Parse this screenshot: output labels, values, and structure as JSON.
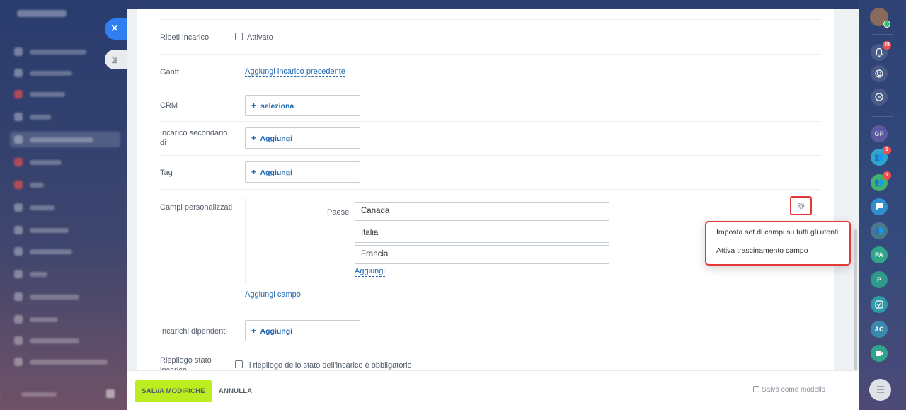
{
  "form": {
    "repeat_task": {
      "label": "Ripeti incarico",
      "checkbox_label": "Attivato"
    },
    "gantt": {
      "label": "Gantt",
      "link": "Aggiungi incarico precedente"
    },
    "crm": {
      "label": "CRM",
      "button": "seleziona"
    },
    "subtask_of": {
      "label": "Incarico secondario di",
      "button": "Aggiungi"
    },
    "tag": {
      "label": "Tag",
      "button": "Aggiungi"
    },
    "custom_fields": {
      "label": "Campi personalizzati",
      "field_label": "Paese",
      "values": [
        "Canada",
        "Italia",
        "Francia"
      ],
      "add_value_link": "Aggiungi",
      "add_field_link": "Aggiungi campo"
    },
    "dependent_tasks": {
      "label": "Incarichi dipendenti",
      "button": "Aggiungi"
    },
    "status_summary": {
      "label": "Riepilogo stato incarico",
      "checkbox_label": "Il riepilogo dello stato dell'incarico è obbligatorio"
    }
  },
  "menu": {
    "items": [
      "Imposta set di campi su tutti gli utenti",
      "Attiva trascinamento campo"
    ]
  },
  "footer": {
    "save": "SALVA MODIFICHE",
    "cancel": "ANNULLA",
    "save_template": "Salva come modello"
  },
  "rail": {
    "notifications_badge": "48",
    "group_badge_1": "1",
    "group_badge_2": "1",
    "avatar_gp": "GP",
    "avatar_pa": "PA",
    "avatar_p": "P",
    "avatar_ac": "AC"
  },
  "colors": {
    "accent": "#2f7ff2",
    "save_button": "#bbed21",
    "highlight": "#e53939",
    "link": "#2067b0"
  }
}
